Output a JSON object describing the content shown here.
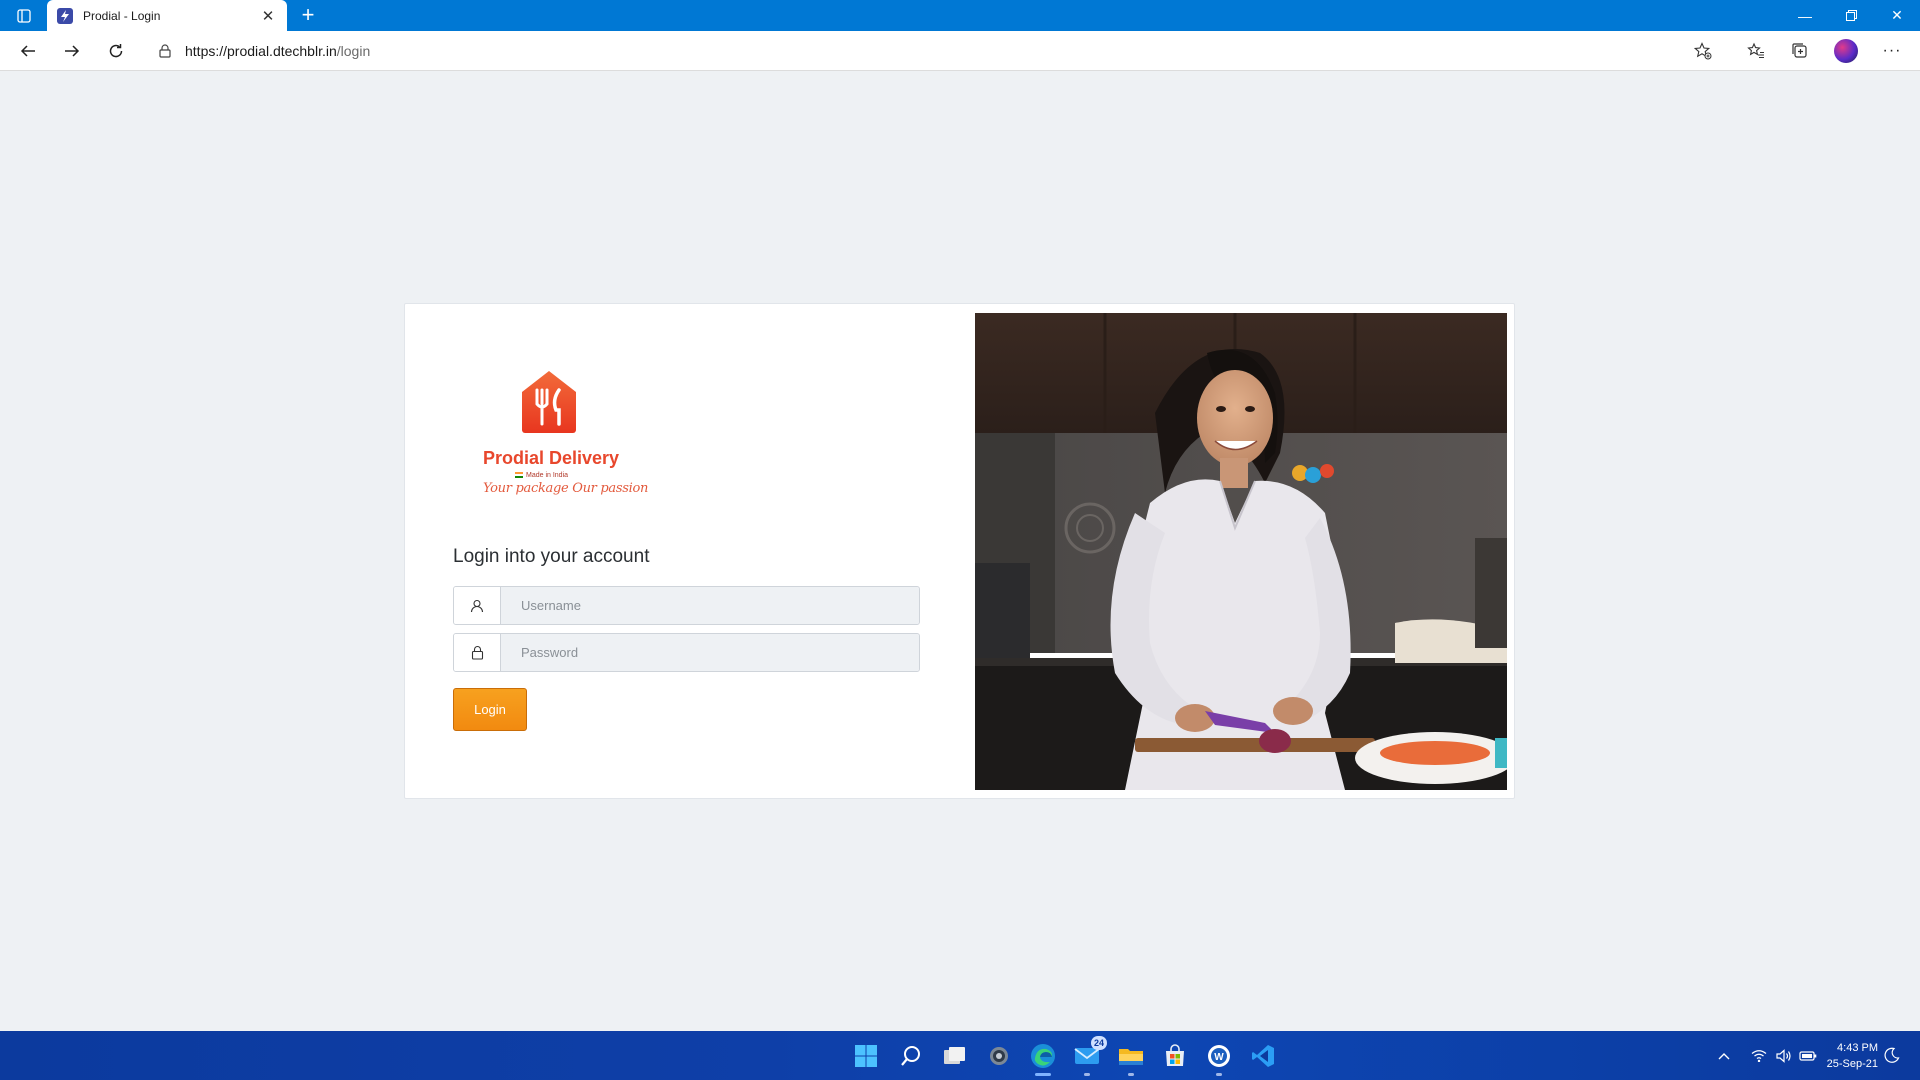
{
  "browser": {
    "tab_title": "Prodial - Login",
    "url_host": "https://prodial.dtechblr.in",
    "url_path": "/login"
  },
  "page": {
    "brand_name": "Prodial Delivery",
    "made_in": "Made in India",
    "tagline": "Your package Our passion",
    "heading": "Login into your account",
    "username_placeholder": "Username",
    "password_placeholder": "Password",
    "login_label": "Login"
  },
  "taskbar": {
    "mail_badge": "24",
    "time": "4:43 PM",
    "date": "25-Sep-21"
  },
  "colors": {
    "browser_accent": "#0078d4",
    "login_button": "#f7941d",
    "brand_red": "#e8472c",
    "taskbar": "#0c3a9e"
  }
}
